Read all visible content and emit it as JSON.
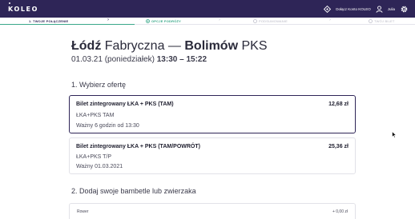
{
  "app": {
    "logo": "KOLEO"
  },
  "topbar": {
    "account_label": "Dołącz Konto KOLEO",
    "user_name": "Julia"
  },
  "steps": [
    {
      "label": "1. TWOJE POŁĄCZENIE",
      "state": "active"
    },
    {
      "label": "OPCJE PODRÓŻY",
      "state": "current"
    },
    {
      "label": "PODSUMOWANIE",
      "state": "pending"
    },
    {
      "label": "TWÓJ BILET",
      "state": "pending"
    }
  ],
  "route": {
    "from_bold": "Łódź",
    "from_rest": " Fabryczna — ",
    "to_bold": "Bolimów",
    "to_rest": " PKS"
  },
  "date": {
    "day": "01.03.21 (poniedziałek)",
    "times": "13:30 – 15:22"
  },
  "sections": {
    "choose_offer": "1. Wybierz ofertę",
    "add_luggage": "2. Dodaj swoje bambetle lub zwierzaka"
  },
  "offers": [
    {
      "name": "Bilet zintegrowany ŁKA + PKS (TAM)",
      "price": "12,68 zł",
      "carrier": "ŁKA+PKS TAM",
      "validity": "Ważny 6 godzin od 13:30",
      "selected": true
    },
    {
      "name": "Bilet zintegrowany ŁKA + PKS (TAM/POWRÓT)",
      "price": "25,36 zł",
      "carrier": "ŁKA+PKS T/P",
      "validity": "Ważny 01.03.2021",
      "selected": false
    }
  ],
  "extras": [
    {
      "label": "Rower",
      "price": "+ 0,00 zł"
    }
  ],
  "colors": {
    "brand": "#2e2557",
    "accent": "#3aa88a"
  }
}
